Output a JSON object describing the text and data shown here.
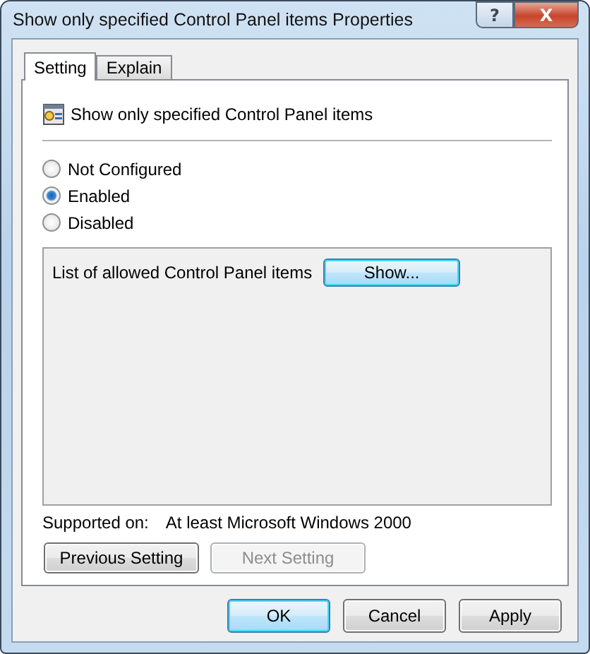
{
  "window": {
    "title": "Show only specified Control Panel items Properties",
    "controls": [
      "?",
      "X"
    ]
  },
  "tabs": [
    {
      "label": "Setting",
      "selected": true
    },
    {
      "label": "Explain",
      "selected": false
    }
  ],
  "setting": {
    "name": "Show only specified Control Panel items"
  },
  "options": [
    {
      "label": "Not Configured",
      "selected": false
    },
    {
      "label": "Enabled",
      "selected": true
    },
    {
      "label": "Disabled",
      "selected": false
    }
  ],
  "options_panel": {
    "label": "List of allowed Control Panel items",
    "button": "Show..."
  },
  "supported_on": {
    "label": "Supported on:",
    "value": "At least Microsoft Windows 2000"
  },
  "nav_buttons": [
    {
      "label": "Previous Setting",
      "disabled": false
    },
    {
      "label": "Next Setting",
      "disabled": true
    }
  ],
  "buttons": [
    {
      "label": "OK",
      "default": true
    },
    {
      "label": "Cancel",
      "default": false
    },
    {
      "label": "Apply",
      "default": false
    }
  ]
}
